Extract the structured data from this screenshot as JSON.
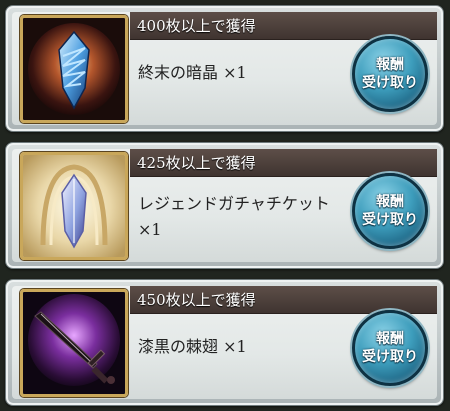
{
  "rewards": [
    {
      "requirement": "400枚以上で獲得",
      "item": "終末の暗晶 ×1",
      "button_line1": "報酬",
      "button_line2": "受け取り",
      "icon": "dark-crystal-icon"
    },
    {
      "requirement": "425枚以上で獲得",
      "item": "レジェンドガチャチケット ×1",
      "button_line1": "報酬",
      "button_line2": "受け取り",
      "icon": "legend-gacha-ticket-icon"
    },
    {
      "requirement": "450枚以上で獲得",
      "item": "漆黒の棘翅 ×1",
      "button_line1": "報酬",
      "button_line2": "受け取り",
      "icon": "black-thorn-wing-icon"
    }
  ],
  "colors": {
    "header_bg": "#4e413c",
    "button_blue": "#3d9dbc",
    "frame_gold": "#c9a75a"
  }
}
